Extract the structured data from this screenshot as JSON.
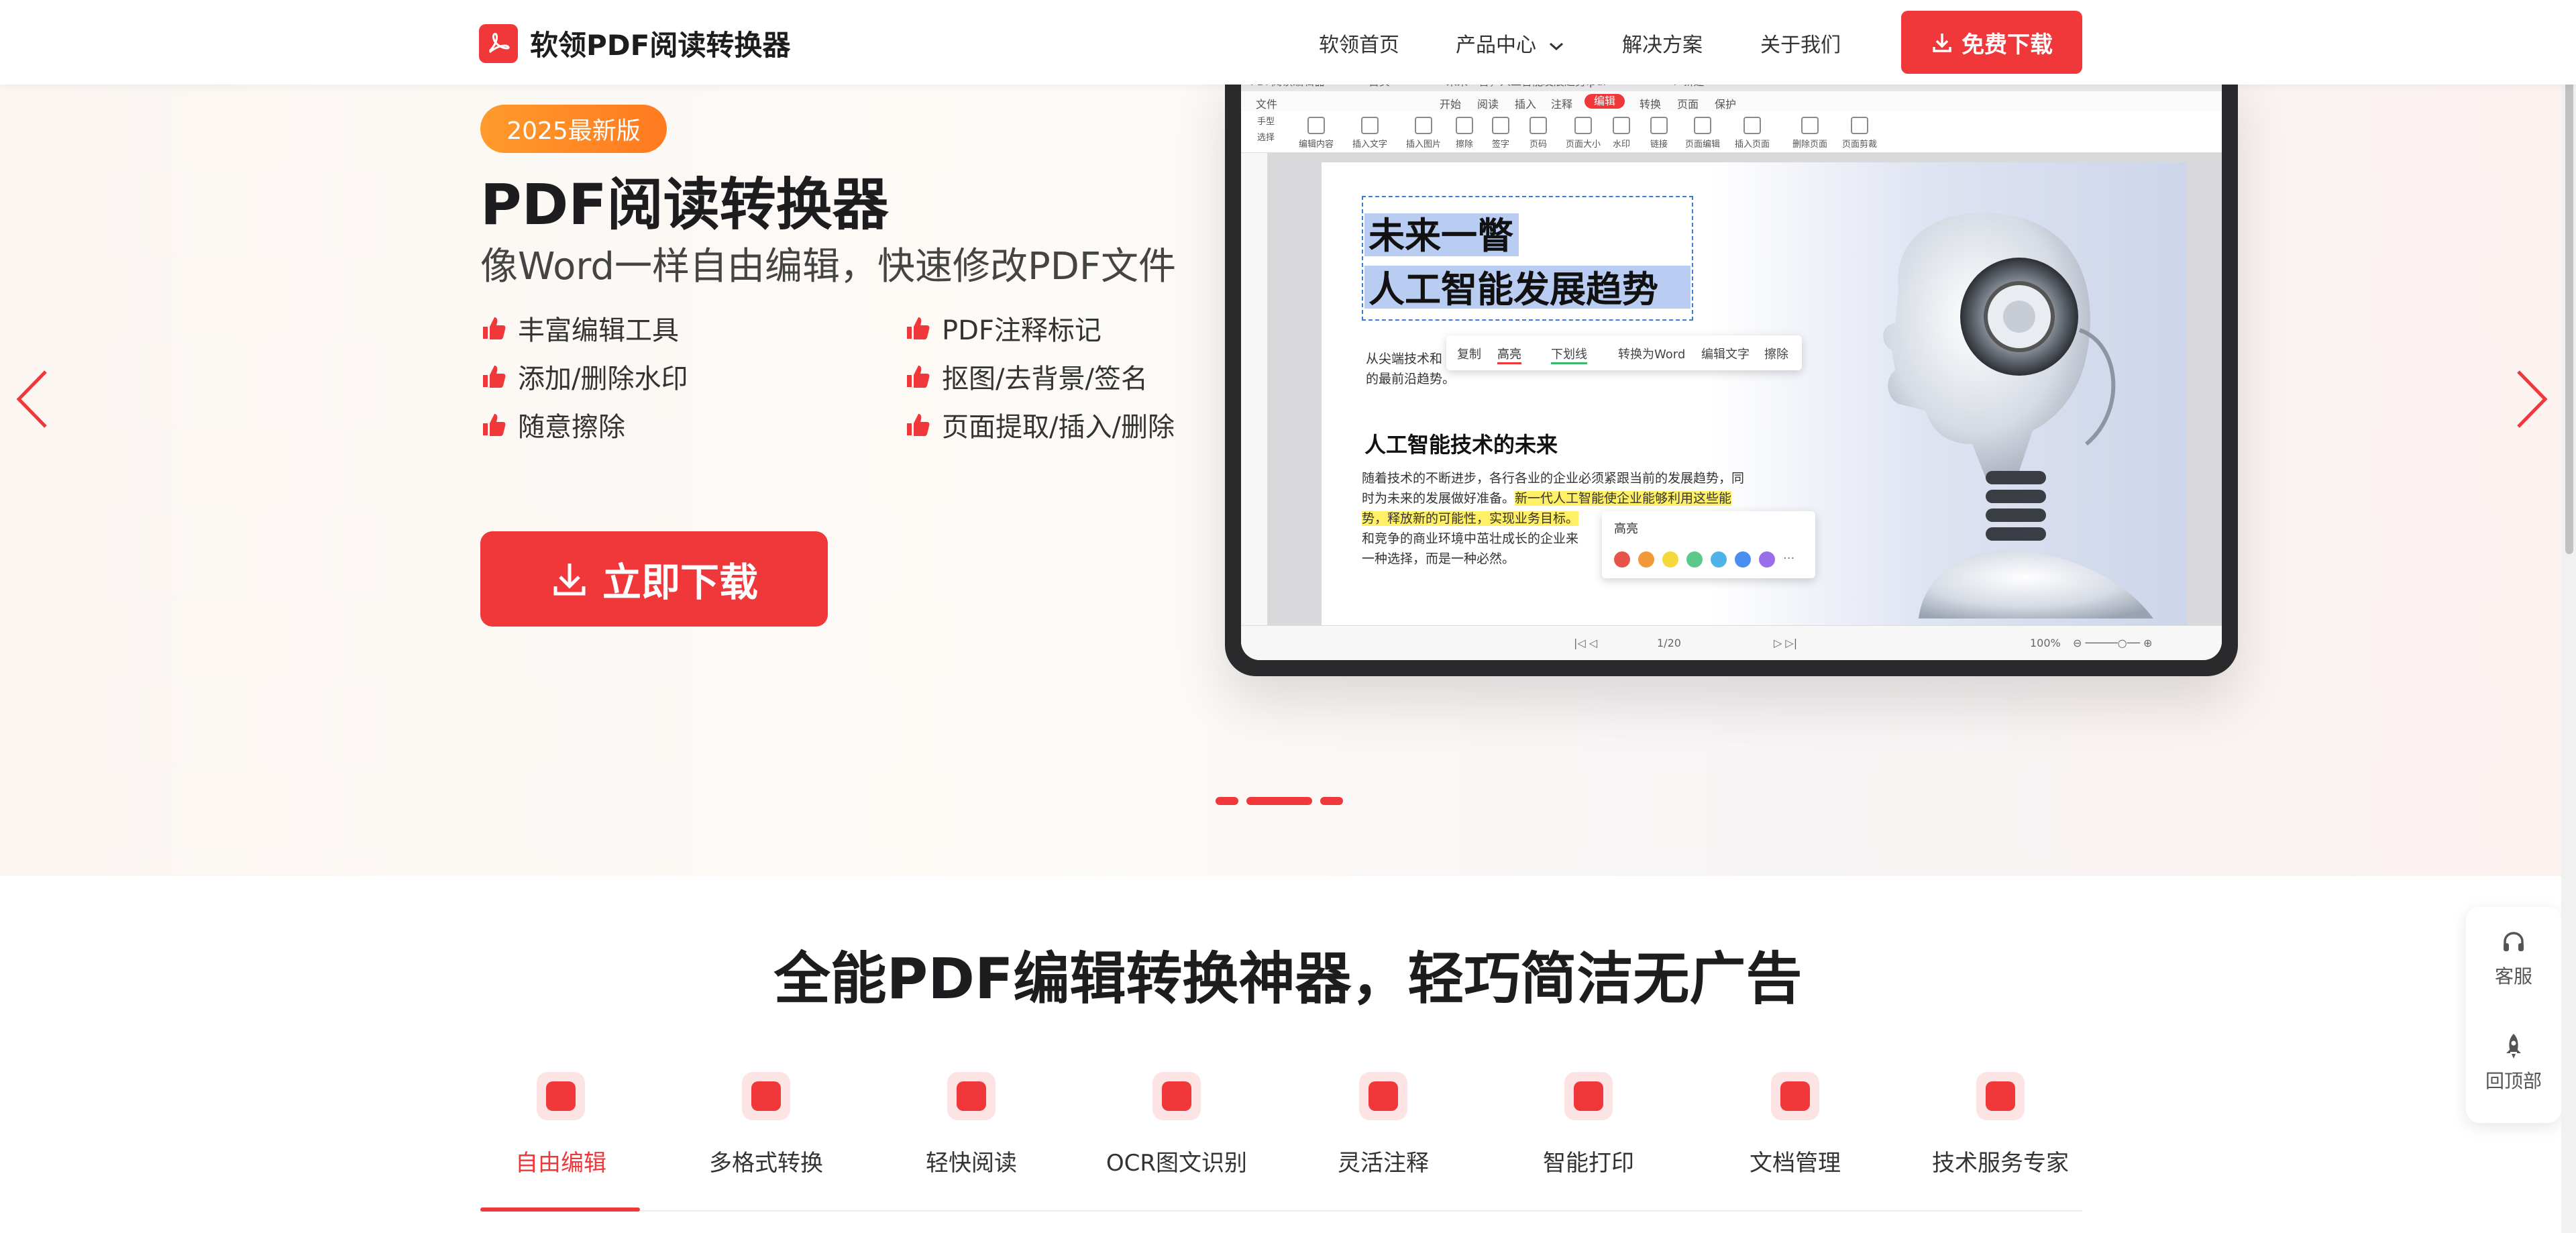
{
  "header": {
    "logo_text": "软领PDF阅读转换器",
    "nav": [
      "软领首页",
      "产品中心",
      "解决方案",
      "关于我们"
    ],
    "download_label": "免费下载"
  },
  "hero": {
    "badge": "2025最新版",
    "title": "PDF阅读转换器",
    "subtitle": "像Word一样自由编辑，快速修改PDF文件",
    "features": [
      "丰富编辑工具",
      "PDF注释标记",
      "添加/删除水印",
      "抠图/去背景/签名",
      "随意擦除",
      "页面提取/插入/删除"
    ],
    "cta": "立即下载",
    "carousel_active": 1
  },
  "mockup": {
    "tabs": [
      "PDF阅读编辑器",
      "首页",
      "未来一瞥，人工智能发展趋势.pdf",
      "+ 新建"
    ],
    "ribbon": [
      "文件",
      "开始",
      "阅读",
      "插入",
      "注释",
      "编辑",
      "转换",
      "页面",
      "保护"
    ],
    "ribbon_active": "编辑",
    "left_tools": [
      "手型",
      "选择"
    ],
    "tools": [
      "编辑内容",
      "插入文字",
      "插入图片",
      "擦除",
      "签字",
      "页码",
      "页面大小",
      "水印",
      "链接",
      "页面编辑",
      "插入页面",
      "删除页面",
      "页面剪裁"
    ],
    "doc_title_1": "未来一瞥",
    "doc_title_2": "人工智能发展趋势",
    "context_menu": [
      "复制",
      "高亮",
      "下划线",
      "转换为Word",
      "编辑文字",
      "擦除"
    ],
    "intro_line_1": "从尖端技术和",
    "intro_line_2": "的最前沿趋势。",
    "section_heading": "人工智能技术的未来",
    "body": [
      "随着技术的不断进步，各行各业的企业必须紧跟当前的发展趋势，同",
      "时为未来的发展做好准备。",
      "新一代人工智能使企业能够利用这些能",
      "势，释放新的可能性，实现业务目标。",
      "和竞争的商业环境中茁壮成长的企业来",
      "一种选择，而是一种必然。"
    ],
    "highlight_popup_title": "高亮",
    "highlight_colors": [
      "#e8534a",
      "#f29a38",
      "#f5d83b",
      "#5cc98a",
      "#4fb3e8",
      "#4a8ef0",
      "#9a6ee8"
    ],
    "page_indicator": "1/20",
    "zoom": "100%"
  },
  "section": {
    "title": "全能PDF编辑转换神器，轻巧简洁无广告",
    "tabs": [
      "自由编辑",
      "多格式转换",
      "轻快阅读",
      "OCR图文识别",
      "灵活注释",
      "智能打印",
      "文档管理",
      "技术服务专家"
    ],
    "active_tab": 0
  },
  "float": {
    "service": "客服",
    "top": "回顶部"
  },
  "colors": {
    "accent": "#f0373a",
    "badge": "#ff8a25"
  }
}
